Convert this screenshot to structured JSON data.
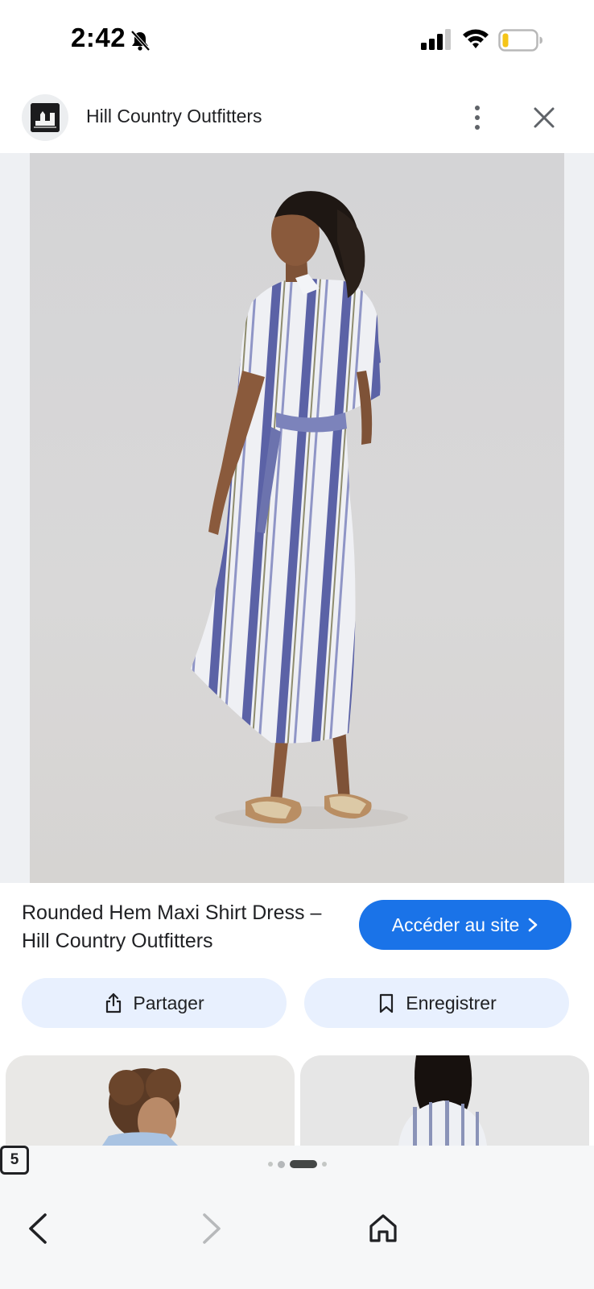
{
  "status_bar": {
    "time": "2:42",
    "icons": [
      "bell-slash-icon",
      "cellular-signal-icon",
      "wifi-icon",
      "battery-low-icon"
    ]
  },
  "header": {
    "site_name": "Hill Country Outfitters",
    "logo_icon": "site-logo",
    "menu_icon": "more-vertical-icon",
    "close_icon": "close-icon"
  },
  "product": {
    "image_icon": "product-photo",
    "title": "Rounded Hem Maxi Shirt Dress – Hill Country Outfitters",
    "visit_label": "Accéder au site"
  },
  "actions": {
    "share_label": "Partager",
    "save_label": "Enregistrer"
  },
  "related": {
    "thumbnail_count_visible": 2
  },
  "pager": {
    "dots": 4,
    "active_index": 2
  },
  "bottom_nav": {
    "tab_count": "5",
    "icons": [
      "back-icon",
      "forward-icon",
      "home-icon",
      "tabs-icon"
    ]
  },
  "colors": {
    "accent": "#1a73e8",
    "action_bg": "#e8f0fe",
    "battery_low": "#f5c518"
  }
}
